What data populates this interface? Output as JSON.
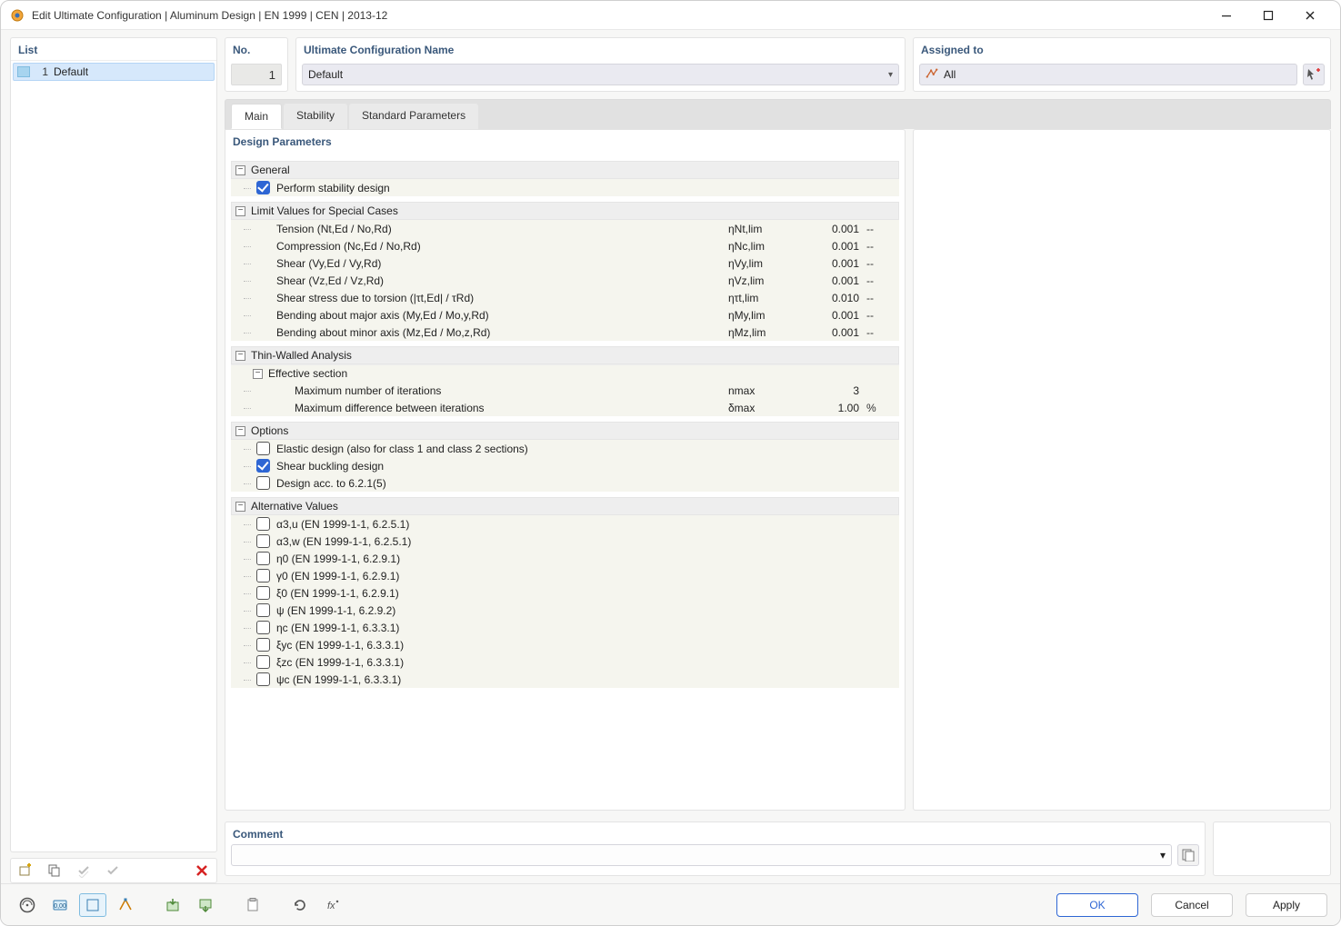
{
  "window": {
    "title": "Edit Ultimate Configuration | Aluminum Design | EN 1999 | CEN | 2013-12"
  },
  "sidebar": {
    "title": "List",
    "items": [
      {
        "index": "1",
        "label": "Default"
      }
    ]
  },
  "header": {
    "no_title": "No.",
    "no_value": "1",
    "name_title": "Ultimate Configuration Name",
    "name_value": "Default",
    "assigned_title": "Assigned to",
    "assigned_value": "All"
  },
  "tabs": {
    "main": "Main",
    "stability": "Stability",
    "standard": "Standard Parameters"
  },
  "params": {
    "title": "Design Parameters",
    "general": {
      "label": "General",
      "perform_stability": "Perform stability design"
    },
    "limits": {
      "label": "Limit Values for Special Cases",
      "rows": [
        {
          "label": "Tension (Nt,Ed / No,Rd)",
          "symbol": "ηNt,lim",
          "value": "0.001",
          "unit": "--"
        },
        {
          "label": "Compression (Nc,Ed / No,Rd)",
          "symbol": "ηNc,lim",
          "value": "0.001",
          "unit": "--"
        },
        {
          "label": "Shear (Vy,Ed / Vy,Rd)",
          "symbol": "ηVy,lim",
          "value": "0.001",
          "unit": "--"
        },
        {
          "label": "Shear (Vz,Ed / Vz,Rd)",
          "symbol": "ηVz,lim",
          "value": "0.001",
          "unit": "--"
        },
        {
          "label": "Shear stress due to torsion (|τt,Ed| / τRd)",
          "symbol": "ητt,lim",
          "value": "0.010",
          "unit": "--"
        },
        {
          "label": "Bending about major axis (My,Ed / Mo,y,Rd)",
          "symbol": "ηMy,lim",
          "value": "0.001",
          "unit": "--"
        },
        {
          "label": "Bending about minor axis (Mz,Ed / Mo,z,Rd)",
          "symbol": "ηMz,lim",
          "value": "0.001",
          "unit": "--"
        }
      ]
    },
    "thin": {
      "label": "Thin-Walled Analysis",
      "sub_label": "Effective section",
      "rows": [
        {
          "label": "Maximum number of iterations",
          "symbol": "nmax",
          "value": "3",
          "unit": ""
        },
        {
          "label": "Maximum difference between iterations",
          "symbol": "δmax",
          "value": "1.00",
          "unit": "%"
        }
      ]
    },
    "options": {
      "label": "Options",
      "rows": [
        {
          "label": "Elastic design (also for class 1 and class 2 sections)",
          "checked": false
        },
        {
          "label": "Shear buckling design",
          "checked": true
        },
        {
          "label": "Design acc. to 6.2.1(5)",
          "checked": false
        }
      ]
    },
    "alt": {
      "label": "Alternative Values",
      "rows": [
        {
          "label": "α3,u (EN 1999-1-1, 6.2.5.1)"
        },
        {
          "label": "α3,w (EN 1999-1-1, 6.2.5.1)"
        },
        {
          "label": "η0 (EN 1999-1-1, 6.2.9.1)"
        },
        {
          "label": "γ0 (EN 1999-1-1, 6.2.9.1)"
        },
        {
          "label": "ξ0 (EN 1999-1-1, 6.2.9.1)"
        },
        {
          "label": "ψ (EN 1999-1-1, 6.2.9.2)"
        },
        {
          "label": "ηc (EN 1999-1-1, 6.3.3.1)"
        },
        {
          "label": "ξyc (EN 1999-1-1, 6.3.3.1)"
        },
        {
          "label": "ξzc (EN 1999-1-1, 6.3.3.1)"
        },
        {
          "label": "ψc (EN 1999-1-1, 6.3.3.1)"
        }
      ]
    }
  },
  "comment": {
    "title": "Comment",
    "value": ""
  },
  "buttons": {
    "ok": "OK",
    "cancel": "Cancel",
    "apply": "Apply"
  }
}
